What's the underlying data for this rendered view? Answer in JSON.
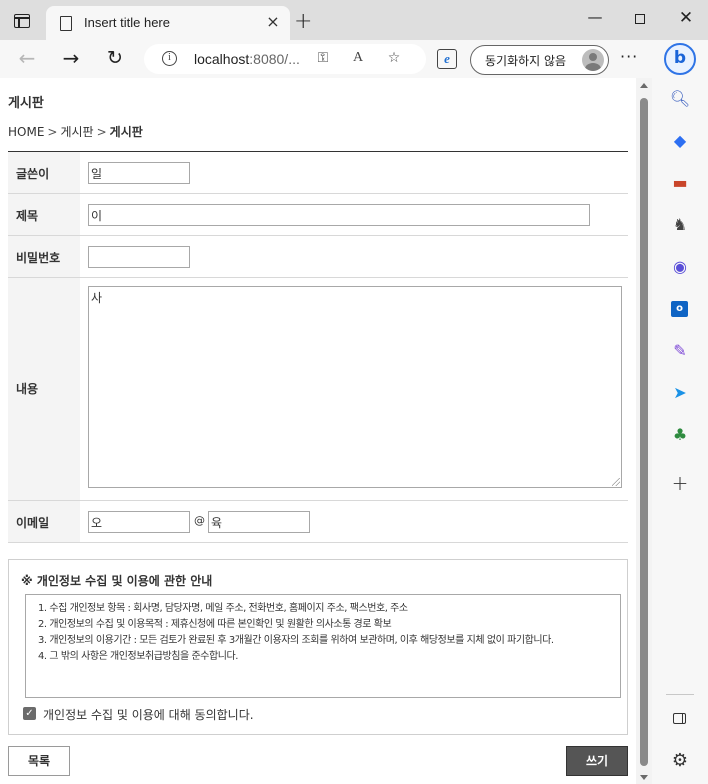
{
  "browser": {
    "tab_title": "Insert title here",
    "tab_close": "×",
    "new_tab": "+",
    "url_host": "localhost",
    "url_rest": ":8080/...",
    "read_aloud_glyph": "A",
    "ie_mode_glyph": "e",
    "sync_label": "동기화하지 않음",
    "more_glyph": "···",
    "bing_glyph": "b",
    "window": {
      "minimize": "—",
      "close": "✕"
    }
  },
  "sidebar": {
    "icons": [
      "search-icon",
      "tag-icon",
      "toolbox-icon",
      "chess-icon",
      "office-icon",
      "outlook-icon",
      "designer-icon",
      "send-icon",
      "tree-icon",
      "add-icon",
      "panel-icon",
      "settings-icon"
    ],
    "outlook_glyph": "o",
    "add_glyph": "+"
  },
  "page": {
    "title": "게시판",
    "breadcrumb": [
      "HOME",
      "게시판",
      "게시판"
    ],
    "breadcrumb_sep": ">"
  },
  "form": {
    "writer": {
      "label": "글쓴이",
      "value": "일"
    },
    "subject": {
      "label": "제목",
      "value": "이"
    },
    "password": {
      "label": "비밀번호",
      "value": ""
    },
    "content": {
      "label": "내용",
      "value": "사"
    },
    "email": {
      "label": "이메일",
      "local": "오",
      "at": "@",
      "domain": "육"
    }
  },
  "privacy": {
    "title": "※ 개인정보 수집 및 이용에 관한 안내",
    "lines": [
      "1. 수집 개인정보 항목 : 회사명, 담당자명, 메일 주소, 전화번호, 홈페이지 주소, 팩스번호, 주소",
      "2. 개인정보의 수집 및 이용목적 : 제휴신청에 따른 본인확인 및 원활한 의사소통 경로 확보",
      "3. 개인정보의 이용기간 : 모든 검토가 완료된 후 3개월간 이용자의 조회를 위하여 보관하며, 이후 해당정보를 지체 없이 파기합니다.",
      "4. 그 밖의 사항은 개인정보취급방침을 준수합니다."
    ],
    "agree_checked": true,
    "agree_label": "개인정보 수집 및 이용에 대해 동의합니다."
  },
  "buttons": {
    "list": "목록",
    "write": "쓰기"
  }
}
